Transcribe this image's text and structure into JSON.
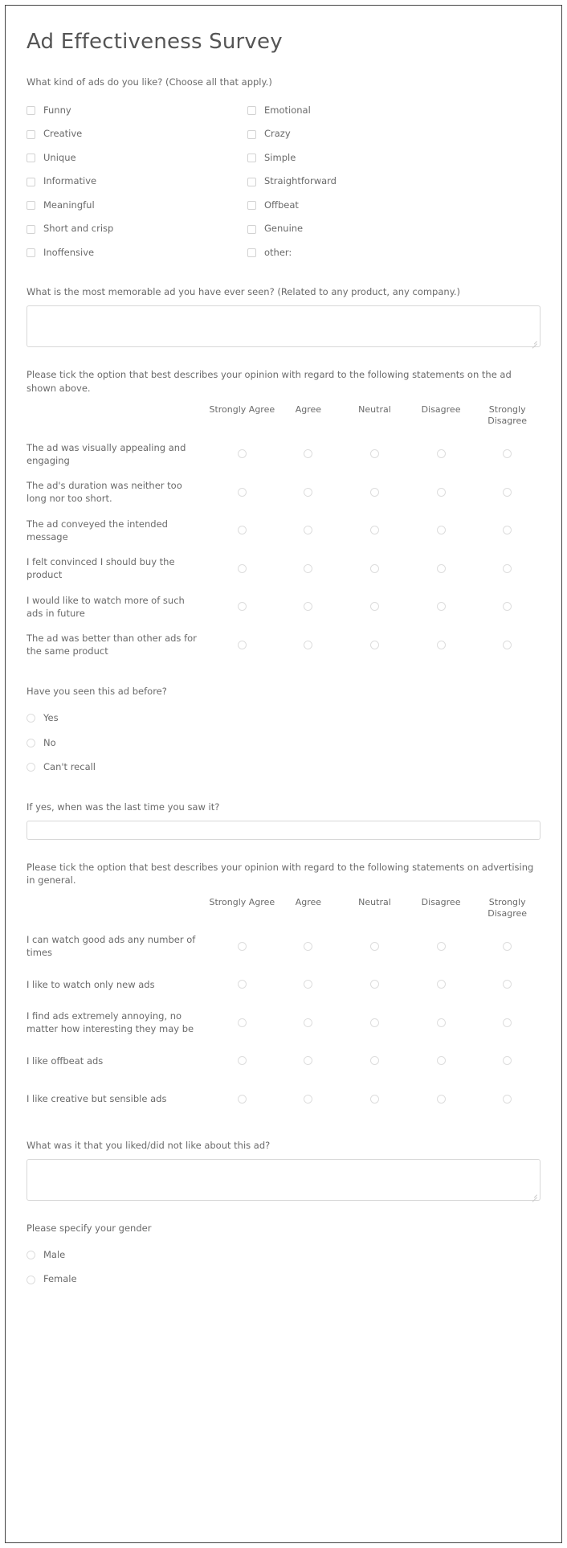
{
  "survey": {
    "title": "Ad Effectiveness Survey"
  },
  "q_ad_types": {
    "prompt": "What kind of ads do you like? (Choose all that apply.)",
    "options_left": [
      "Funny",
      "Creative",
      "Unique",
      "Informative",
      "Meaningful",
      "Short and crisp",
      "Inoffensive"
    ],
    "options_right": [
      "Emotional",
      "Crazy",
      "Simple",
      "Straightforward",
      "Offbeat",
      "Genuine",
      "other:"
    ]
  },
  "q_memorable_ad": {
    "prompt": "What is the most memorable ad you have ever seen? (Related to any product, any company.)",
    "value": "",
    "placeholder": ""
  },
  "q_matrix_this_ad": {
    "prompt": "Please tick the option that best describes your opinion with regard to the following statements on the ad shown above.",
    "columns": [
      "Strongly Agree",
      "Agree",
      "Neutral",
      "Disagree",
      "Strongly Disagree"
    ],
    "rows": [
      "The ad was visually appealing and engaging",
      "The ad's duration was neither too long nor too short.",
      "The ad conveyed the intended message",
      "I felt convinced I should buy the product",
      "I would like to watch more of such ads in future",
      "The ad was better than other ads for the same product"
    ]
  },
  "q_seen_before": {
    "prompt": "Have you seen this ad before?",
    "options": [
      "Yes",
      "No",
      "Can't recall"
    ]
  },
  "q_last_time": {
    "prompt": "If yes, when was the last time you saw it?",
    "value": "",
    "placeholder": ""
  },
  "q_matrix_general": {
    "prompt": "Please tick the option that best describes your opinion with regard to the following statements on advertising in general.",
    "columns": [
      "Strongly Agree",
      "Agree",
      "Neutral",
      "Disagree",
      "Strongly Disagree"
    ],
    "rows": [
      "I can watch good ads any number of times",
      "I like to watch only new ads",
      "I find ads extremely annoying, no matter how interesting they may be",
      "I like offbeat ads",
      "I like creative but sensible ads"
    ]
  },
  "q_liked_disliked": {
    "prompt": "What was it that you liked/did not like about this ad?",
    "value": "",
    "placeholder": ""
  },
  "q_gender": {
    "prompt": "Please specify your gender",
    "options": [
      "Male",
      "Female"
    ]
  }
}
